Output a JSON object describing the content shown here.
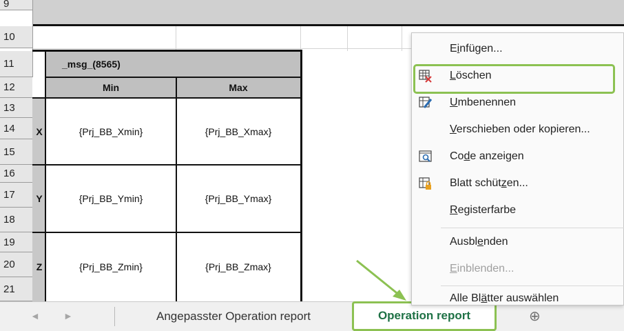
{
  "sheet": {
    "rows": [
      "9",
      "10",
      "11",
      "12",
      "13",
      "14",
      "15",
      "16",
      "17",
      "18",
      "19",
      "20",
      "21"
    ],
    "table": {
      "title": "_msg_(8565)",
      "col_min": "Min",
      "col_max": "Max",
      "axes": [
        {
          "label": "X",
          "min": "{Prj_BB_Xmin}",
          "max": "{Prj_BB_Xmax}"
        },
        {
          "label": "Y",
          "min": "{Prj_BB_Ymin}",
          "max": "{Prj_BB_Ymax}"
        },
        {
          "label": "Z",
          "min": "{Prj_BB_Zmin}",
          "max": "{Prj_BB_Zmax}"
        }
      ]
    }
  },
  "tabs": {
    "prev_icon": "◄",
    "next_icon": "►",
    "items": [
      "Angepasster Operation report",
      "Operation report"
    ],
    "add_icon": "⊕"
  },
  "context_menu": {
    "items": [
      {
        "pre": "E",
        "u": "i",
        "post": "nfügen...",
        "icon": "none",
        "disabled": false
      },
      {
        "pre": "",
        "u": "L",
        "post": "öschen",
        "icon": "delete-sheet-icon",
        "disabled": false
      },
      {
        "pre": "",
        "u": "U",
        "post": "mbenennen",
        "icon": "rename-sheet-icon",
        "disabled": false
      },
      {
        "pre": "",
        "u": "V",
        "post": "erschieben oder kopieren...",
        "icon": "none",
        "disabled": false
      },
      {
        "pre": "Co",
        "u": "d",
        "post": "e anzeigen",
        "icon": "view-code-icon",
        "disabled": false
      },
      {
        "pre": "Blatt schüt",
        "u": "z",
        "post": "en...",
        "icon": "protect-sheet-icon",
        "disabled": false
      },
      {
        "pre": "",
        "u": "R",
        "post": "egisterfarbe",
        "icon": "none",
        "disabled": false
      },
      {
        "pre": "Ausbl",
        "u": "e",
        "post": "nden",
        "icon": "none",
        "disabled": false
      },
      {
        "pre": "",
        "u": "E",
        "post": "inblenden...",
        "icon": "none",
        "disabled": true
      },
      {
        "pre": "Alle Bl",
        "u": "ä",
        "post": "tter auswählen",
        "icon": "none",
        "disabled": false
      }
    ]
  }
}
